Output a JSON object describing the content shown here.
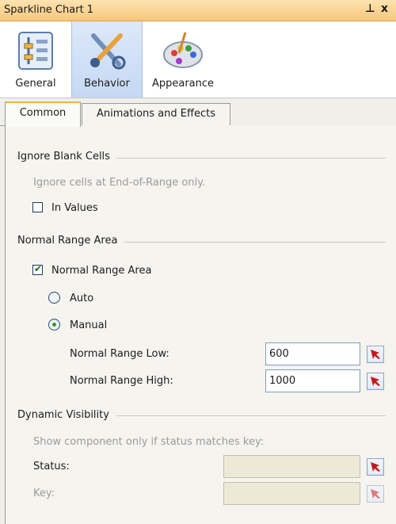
{
  "window": {
    "title": "Sparkline Chart 1",
    "pin_glyph": "⊥",
    "close_glyph": "x"
  },
  "toolbar": {
    "buttons": [
      {
        "label": "General",
        "icon": "general-properties-icon",
        "active": false
      },
      {
        "label": "Behavior",
        "icon": "behavior-tools-icon",
        "active": true
      },
      {
        "label": "Appearance",
        "icon": "palette-icon",
        "active": false
      }
    ]
  },
  "tabs": [
    {
      "label": "Common",
      "active": true
    },
    {
      "label": "Animations and Effects",
      "active": false
    }
  ],
  "ignore_blank": {
    "heading": "Ignore Blank Cells",
    "hint": "Ignore cells at End-of-Range only.",
    "in_values": {
      "label": "In Values",
      "checked": false
    }
  },
  "normal_range": {
    "heading": "Normal Range Area",
    "enable": {
      "label": "Normal Range Area",
      "checked": true
    },
    "mode_auto": {
      "label": "Auto",
      "selected": false
    },
    "mode_manual": {
      "label": "Manual",
      "selected": true
    },
    "low": {
      "label": "Normal Range Low:",
      "value": "600"
    },
    "high": {
      "label": "Normal Range High:",
      "value": "1000"
    }
  },
  "dynamic_visibility": {
    "heading": "Dynamic Visibility",
    "hint": "Show component only if status matches key:",
    "status": {
      "label": "Status:",
      "value": ""
    },
    "key": {
      "label": "Key:",
      "value": ""
    }
  },
  "colors": {
    "title_bar": "#f7c77c",
    "active_tab_accent": "#f2b441",
    "selected_button": "#c5d8f3"
  }
}
